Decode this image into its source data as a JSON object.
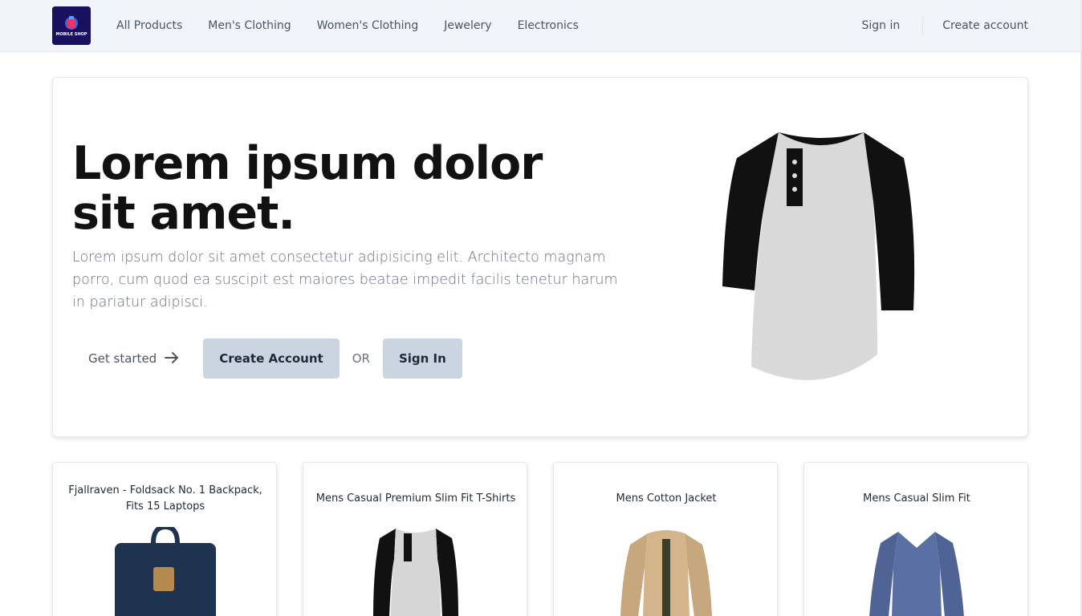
{
  "header": {
    "logo_text": "MOBILE SHOP",
    "nav": [
      "All Products",
      "Men's Clothing",
      "Women's Clothing",
      "Jewelery",
      "Electronics"
    ],
    "sign_in": "Sign in",
    "create_account": "Create account"
  },
  "hero": {
    "title": "Lorem ipsum dolor sit amet.",
    "description": "Lorem ipsum dolor sit amet consectetur adipisicing elit. Architecto magnam porro, cum quod ea suscipit est maiores beatae impedit facilis tenetur harum in pariatur adipisci.",
    "get_started": "Get started",
    "create_account_button": "Create Account",
    "or": "OR",
    "sign_in_button": "Sign In"
  },
  "products": [
    {
      "title": "Fjallraven - Foldsack No. 1 Backpack, Fits 15 Laptops"
    },
    {
      "title": "Mens Casual Premium Slim Fit T-Shirts"
    },
    {
      "title": "Mens Cotton Jacket"
    },
    {
      "title": "Mens Casual Slim Fit"
    }
  ],
  "colors": {
    "header_bg": "#f1f4f8",
    "button_bg": "#cbd5e1",
    "logo_bg": "#1a1060"
  },
  "icons": [
    "arrow-right-icon",
    "shop-logo-icon"
  ]
}
